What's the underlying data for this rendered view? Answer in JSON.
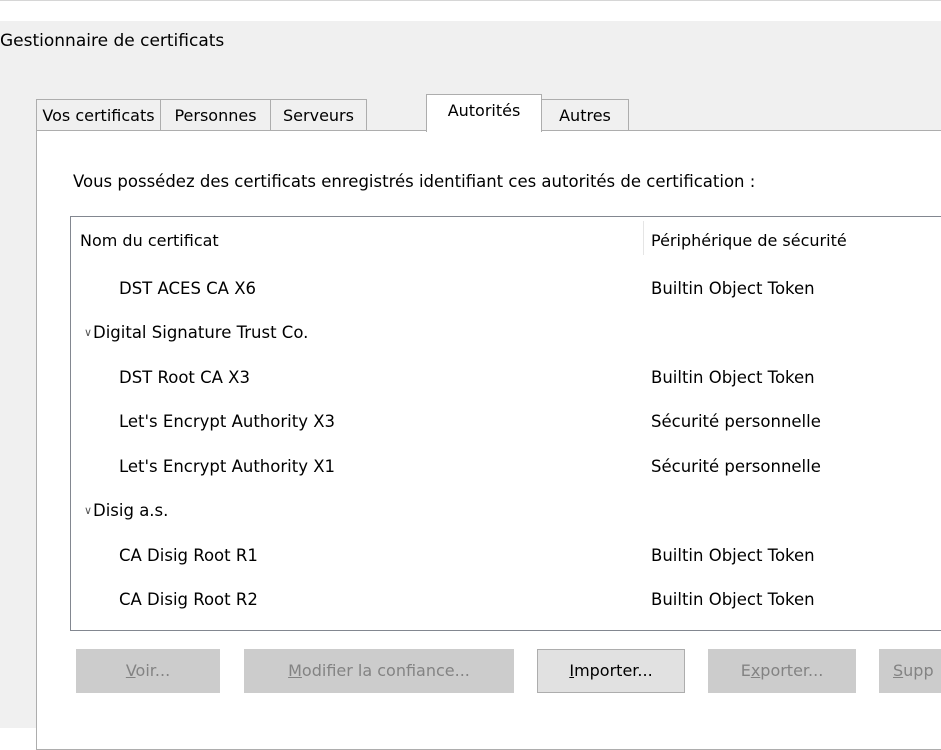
{
  "dialog": {
    "title": "Gestionnaire de certificats"
  },
  "tabs": [
    {
      "label": "Vos certificats",
      "active": false
    },
    {
      "label": "Personnes",
      "active": false
    },
    {
      "label": "Serveurs",
      "active": false
    },
    {
      "label": "Autorités",
      "active": true
    },
    {
      "label": "Autres",
      "active": false
    }
  ],
  "panel": {
    "description": "Vous possédez des certificats enregistrés identifiant ces autorités de certification :"
  },
  "tree": {
    "columns": [
      "Nom du certificat",
      "Périphérique de sécurité"
    ],
    "rows": [
      {
        "name": "DST ACES CA X6",
        "device": "Builtin Object Token",
        "group": false
      },
      {
        "name": "Digital Signature Trust Co.",
        "device": "",
        "group": true,
        "expanded": true
      },
      {
        "name": "DST Root CA X3",
        "device": "Builtin Object Token",
        "group": false
      },
      {
        "name": "Let's Encrypt Authority X3",
        "device": "Sécurité personnelle",
        "group": false
      },
      {
        "name": "Let's Encrypt Authority X1",
        "device": "Sécurité personnelle",
        "group": false
      },
      {
        "name": "Disig a.s.",
        "device": "",
        "group": true,
        "expanded": true
      },
      {
        "name": "CA Disig Root R1",
        "device": "Builtin Object Token",
        "group": false
      },
      {
        "name": "CA Disig Root R2",
        "device": "Builtin Object Token",
        "group": false
      }
    ]
  },
  "buttons": {
    "view": {
      "mnemonic": "V",
      "rest": "oir...",
      "enabled": false
    },
    "edit_trust": {
      "mnemonic": "M",
      "rest": "odifier la confiance...",
      "enabled": false
    },
    "import": {
      "mnemonic": "I",
      "rest": "mporter...",
      "enabled": true
    },
    "export_pre": "E",
    "export": {
      "mnemonic": "x",
      "rest": "porter...",
      "enabled": false
    },
    "delete": {
      "mnemonic": "S",
      "rest": "upp",
      "enabled": false
    }
  },
  "icons": {
    "expand": "chevron-down-icon"
  }
}
